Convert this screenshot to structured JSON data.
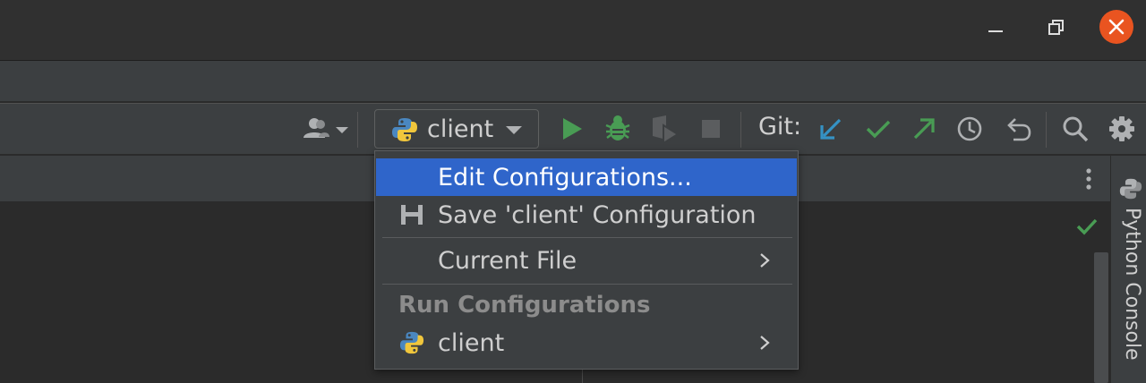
{
  "toolbar": {
    "run_config_name": "client",
    "git_label": "Git:"
  },
  "popup": {
    "items": [
      {
        "label": "Edit Configurations...",
        "selected": true
      },
      {
        "label": "Save 'client' Configuration"
      },
      {
        "label": "Current File",
        "submenu": true
      }
    ],
    "group_header": "Run Configurations",
    "configurations": [
      {
        "label": "client",
        "submenu": true
      }
    ]
  },
  "side_panel": {
    "label": "Python Console"
  },
  "colors": {
    "accent_selection": "#2f65ca",
    "run_green": "#499c54",
    "git_update_blue": "#3592c4",
    "close_orange": "#e95420"
  },
  "icons": {
    "window": [
      "minimize-icon",
      "maximize-icon",
      "close-icon"
    ],
    "toolbar": [
      "user-icon",
      "python-icon",
      "dropdown-caret-icon",
      "run-icon",
      "debug-icon",
      "coverage-icon",
      "stop-icon",
      "git-update-icon",
      "git-commit-icon",
      "git-push-icon",
      "history-icon",
      "rollback-icon",
      "search-icon",
      "settings-icon"
    ]
  }
}
